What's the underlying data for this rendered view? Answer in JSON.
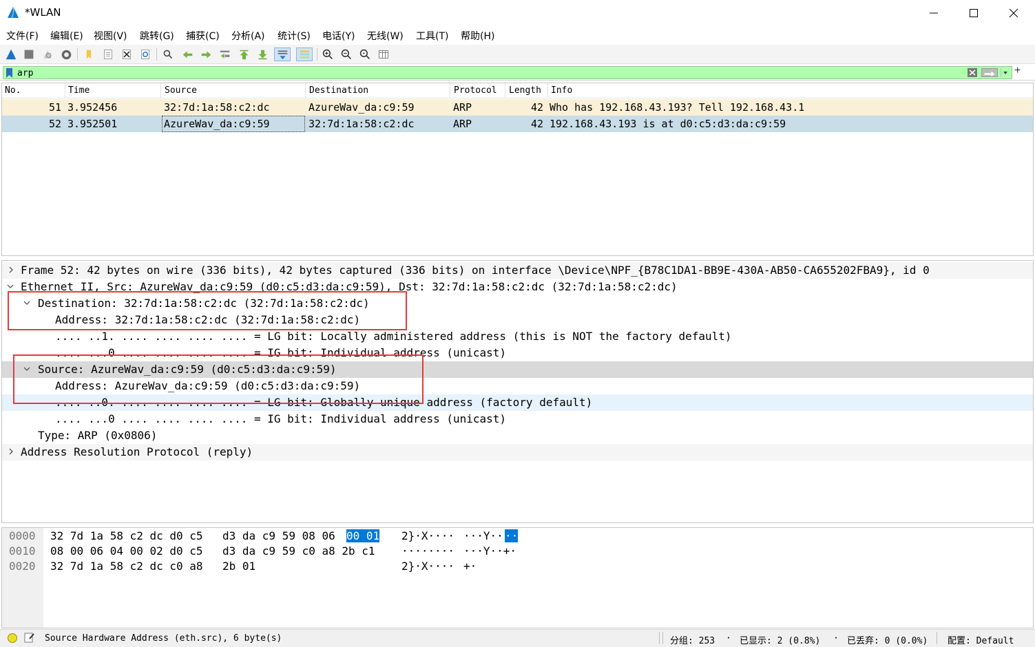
{
  "window": {
    "title": "*WLAN",
    "minimize_icon": "minimize-icon",
    "maximize_icon": "maximize-icon",
    "close_icon": "close-icon"
  },
  "menu": [
    {
      "label": "文件(F)"
    },
    {
      "label": "编辑(E)"
    },
    {
      "label": "视图(V)"
    },
    {
      "label": "跳转(G)"
    },
    {
      "label": "捕获(C)"
    },
    {
      "label": "分析(A)"
    },
    {
      "label": "统计(S)"
    },
    {
      "label": "电话(Y)"
    },
    {
      "label": "无线(W)"
    },
    {
      "label": "工具(T)"
    },
    {
      "label": "帮助(H)"
    }
  ],
  "toolbar": {
    "icons": [
      "start-capture-icon",
      "stop-capture-icon",
      "restart-capture-icon",
      "capture-options-icon",
      "open-file-icon",
      "save-file-icon",
      "close-file-icon",
      "reload-file-icon",
      "find-packet-icon",
      "go-back-icon",
      "go-forward-icon",
      "go-to-packet-icon",
      "go-first-icon",
      "go-last-icon",
      "autoscroll-icon",
      "colorize-icon",
      "zoom-in-icon",
      "zoom-out-icon",
      "normal-size-icon",
      "resize-columns-icon"
    ]
  },
  "filter": {
    "value": "arp",
    "accent": "#afffaf"
  },
  "packet_list": {
    "columns": [
      "No.",
      "Time",
      "Source",
      "Destination",
      "Protocol",
      "Length",
      "Info"
    ],
    "rows": [
      {
        "no": "51",
        "time": "3.952456",
        "source": "32:7d:1a:58:c2:dc",
        "destination": "AzureWav_da:c9:59",
        "protocol": "ARP",
        "length": "42",
        "info": "Who has 192.168.43.193? Tell 192.168.43.1",
        "color": "#faf0d7"
      },
      {
        "no": "52",
        "time": "3.952501",
        "source": "AzureWav_da:c9:59",
        "destination": "32:7d:1a:58:c2:dc",
        "protocol": "ARP",
        "length": "42",
        "info": "192.168.43.193 is at d0:c5:d3:da:c9:59",
        "color": "#c9dde8"
      }
    ]
  },
  "details": [
    {
      "text": "Frame 52: 42 bytes on wire (336 bits), 42 bytes captured (336 bits) on interface \\Device\\NPF_{B78C1DA1-BB9E-430A-AB50-CA655202FBA9}, id 0",
      "expander": "collapsed"
    },
    {
      "text": "Ethernet II, Src: AzureWav_da:c9:59 (d0:c5:d3:da:c9:59), Dst: 32:7d:1a:58:c2:dc (32:7d:1a:58:c2:dc)",
      "expander": "expanded"
    },
    {
      "text": "Destination: 32:7d:1a:58:c2:dc (32:7d:1a:58:c2:dc)",
      "expander": "expanded"
    },
    {
      "text": "Address: 32:7d:1a:58:c2:dc (32:7d:1a:58:c2:dc)",
      "expander": "none"
    },
    {
      "text": ".... ..1. .... .... .... .... = LG bit: Locally administered address (this is NOT the factory default)",
      "expander": "none"
    },
    {
      "text": ".... ...0 .... .... .... .... = IG bit: Individual address (unicast)",
      "expander": "none"
    },
    {
      "text": "Source: AzureWav_da:c9:59 (d0:c5:d3:da:c9:59)",
      "expander": "expanded"
    },
    {
      "text": "Address: AzureWav_da:c9:59 (d0:c5:d3:da:c9:59)",
      "expander": "none"
    },
    {
      "text": ".... ..0. .... .... .... .... = LG bit: Globally unique address (factory default)",
      "expander": "none"
    },
    {
      "text": ".... ...0 .... .... .... .... = IG bit: Individual address (unicast)",
      "expander": "none"
    },
    {
      "text": "Type: ARP (0x0806)",
      "expander": "none"
    },
    {
      "text": "Address Resolution Protocol (reply)",
      "expander": "collapsed"
    }
  ],
  "hex": [
    {
      "offset": "0000",
      "bytes_a": "32 7d 1a 58 c2 dc d0 c5",
      "bytes_b": "d3 da c9 59 08 06",
      "bytes_hl": "00 01",
      "ascii": "2}·X····",
      "ascii_b": "···Y··",
      "ascii_hl": "··"
    },
    {
      "offset": "0010",
      "bytes_a": "08 00 06 04 00 02 d0 c5",
      "bytes_b": "d3 da c9 59 c0 a8 2b c1",
      "bytes_hl": "",
      "ascii": "········",
      "ascii_b": "···Y··+·",
      "ascii_hl": ""
    },
    {
      "offset": "0020",
      "bytes_a": "32 7d 1a 58 c2 dc c0 a8",
      "bytes_b": "2b 01",
      "bytes_hl": "",
      "ascii": "2}·X····",
      "ascii_b": "+·",
      "ascii_hl": ""
    }
  ],
  "status": {
    "field": "Source Hardware Address (eth.src), 6 byte(s)",
    "packets": "分组: 253",
    "displayed": "已显示: 2 (0.8%)",
    "dropped": "已丢弃: 0 (0.0%)",
    "profile": "配置: Default"
  }
}
